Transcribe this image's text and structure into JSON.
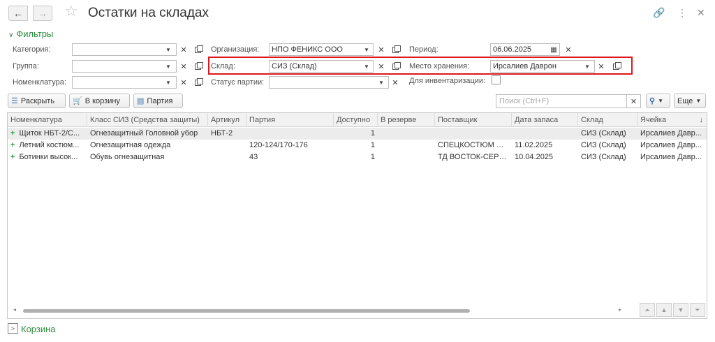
{
  "window": {
    "title": "Остатки на складах",
    "back_icon": "←",
    "forward_icon": "→"
  },
  "filters": {
    "header": "Фильтры",
    "category": {
      "label": "Категория:",
      "value": ""
    },
    "group": {
      "label": "Группа:",
      "value": ""
    },
    "nomenclature": {
      "label": "Номенклатура:",
      "value": ""
    },
    "organization": {
      "label": "Организация:",
      "value": "НПО ФЕНИКС ООО"
    },
    "warehouse": {
      "label": "Склад:",
      "value": "СИЗ (Склад)"
    },
    "batch_status": {
      "label": "Статус партии:",
      "value": ""
    },
    "period": {
      "label": "Период:",
      "value": "06.06.2025"
    },
    "storage_place": {
      "label": "Место хранения:",
      "value": "Ирсалиев Даврон"
    },
    "for_inventory": {
      "label": "Для инвентаризации:",
      "checked": false
    }
  },
  "toolbar": {
    "expand_label": "Раскрыть",
    "to_cart_label": "В корзину",
    "batch_label": "Партия",
    "search_placeholder": "Поиск (Ctrl+F)",
    "more_label": "Еще"
  },
  "table": {
    "columns": [
      "Номенклатура",
      "Класс СИЗ (Средства защиты)",
      "Артикул",
      "Партия",
      "Доступно",
      "В резерве",
      "Поставщик",
      "Дата запаса",
      "Склад",
      "Ячейка"
    ],
    "rows": [
      {
        "nomenclature": "Щиток НБТ-2/С...",
        "class": "Огнезащитный Головной убор",
        "article": "НБТ-2",
        "batch": "",
        "available": "1",
        "reserved": "",
        "supplier": "",
        "date": "",
        "warehouse": "СИЗ (Склад)",
        "cell": "Ирсалиев Давр..."
      },
      {
        "nomenclature": "Летний костюм...",
        "class": "Огнезащитная одежда",
        "article": "",
        "batch": "120-124/170-176",
        "available": "1",
        "reserved": "",
        "supplier": "СПЕЦКОСТЮМ ОО...",
        "date": "11.02.2025",
        "warehouse": "СИЗ (Склад)",
        "cell": "Ирсалиев Давр..."
      },
      {
        "nomenclature": "Ботинки высок...",
        "class": "Обувь огнезащитная",
        "article": "",
        "batch": "43",
        "available": "1",
        "reserved": "",
        "supplier": "ТД ВОСТОК-СЕРВ...",
        "date": "10.04.2025",
        "warehouse": "СИЗ (Склад)",
        "cell": "Ирсалиев Давр..."
      }
    ]
  },
  "cart": {
    "label": "Корзина"
  },
  "colors": {
    "accent_green": "#2e8b3e",
    "highlight_red": "#e0161c"
  }
}
